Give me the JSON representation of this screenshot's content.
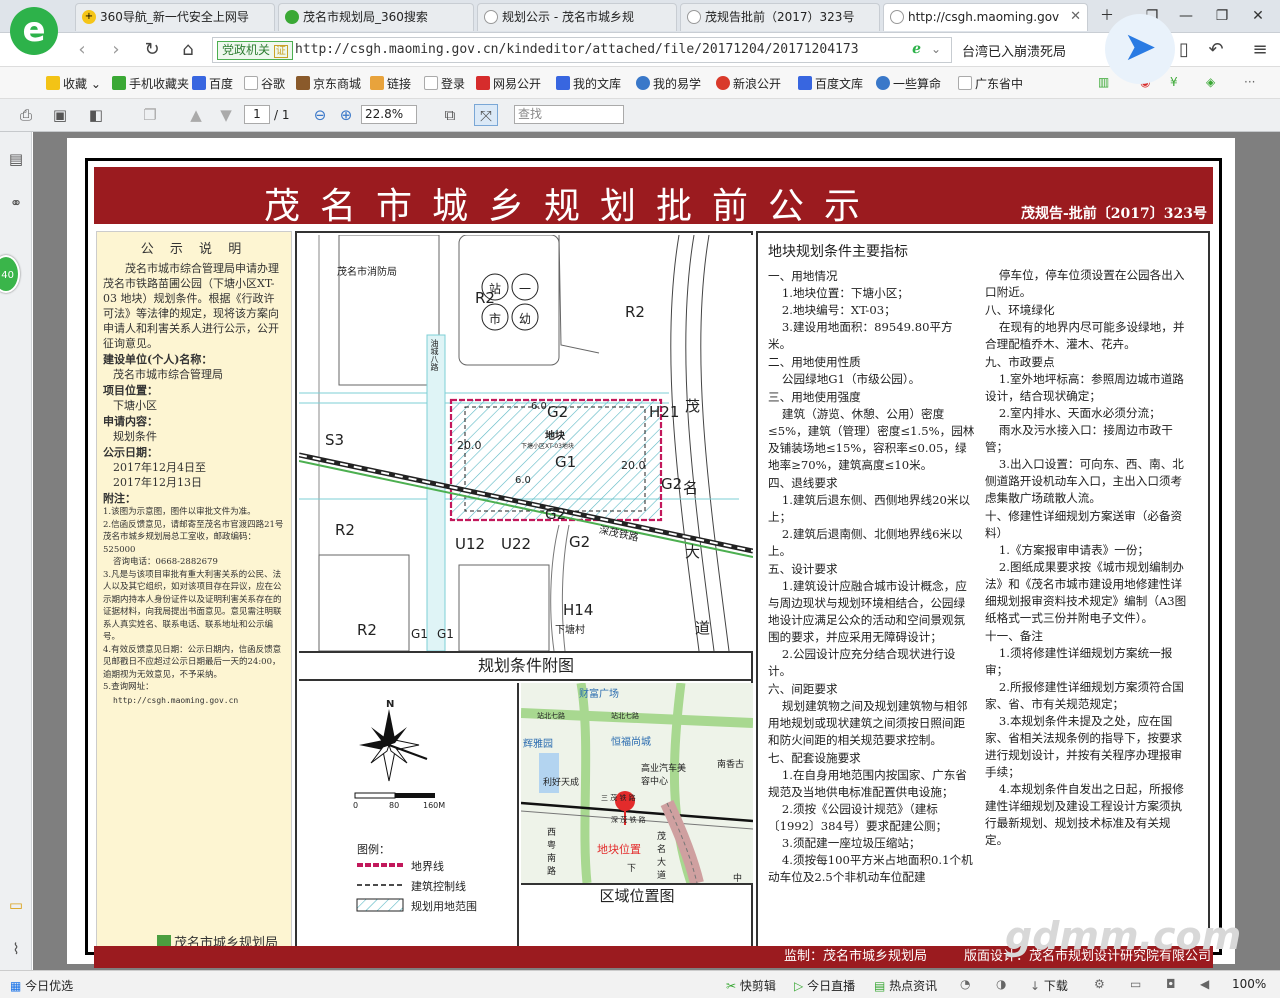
{
  "browser": {
    "tabs": [
      {
        "label": "360导航_新一代安全上网导"
      },
      {
        "label": "茂名市规划局_360搜索"
      },
      {
        "label": "规划公示 - 茂名市城乡规"
      },
      {
        "label": "茂规告批前（2017）323号"
      },
      {
        "label": "http://csgh.maoming.gov"
      }
    ],
    "url": "http://csgh.maoming.gov.cn/kindeditor/attached/file/20171204/20171204173",
    "url_badge": "党政机关",
    "badge_mark": "证",
    "search_text": "台湾已入崩溃死局"
  },
  "bookmarks": [
    "收藏",
    "手机收藏夹",
    "百度",
    "谷歌",
    "京东商城",
    "链接",
    "登录",
    "网易公开",
    "我的文库",
    "我的易学",
    "新浪公开",
    "百度文库",
    "一些算命",
    "广东省中"
  ],
  "pdf_toolbar": {
    "page": "1",
    "total": "/ 1",
    "zoom": "22.8%",
    "find_placeholder": "查找"
  },
  "side_badge": "40",
  "document": {
    "title": "茂名市城乡规划批前公示",
    "doc_number": "茂规告-批前〔2017〕323号",
    "notice_heading": "公 示 说 明",
    "notice_text": "茂名市城市综合管理局申请办理茂名市铁路苗圃公园（下塘小区XT-03 地块）规划条件。根据《行政许可法》等法律的规定，现将该方案向申请人和利害关系人进行公示，公开征询意见。",
    "fields": [
      {
        "key": "建设单位(个人)名称：",
        "value": "茂名市城市综合管理局"
      },
      {
        "key": "项目位置：",
        "value": "下塘小区"
      },
      {
        "key": "申请内容：",
        "value": "规划条件"
      },
      {
        "key": "公示日期：",
        "value": "2017年12月4日至"
      },
      {
        "key": "",
        "value": "2017年12月13日"
      }
    ],
    "notes_heading": "附注：",
    "notes": [
      "1.该图为示意图，图件以审批文件为准。",
      "2.信函反馈意见，请邮寄至茂名市官渡四路21号茂名市城乡规划局总工室收，邮政编码：525000",
      "咨询电话：0668-2882679",
      "3.凡是与该项目审批有重大利害关系的公民、法人以及其它组织，如对该项目存在异议，应在公示期内持本人身份证件以及证明利害关系存在的证据材料，向我局提出书面意见。意见需注明联系人真实姓名、联系电话、联系地址和公示编号。",
      "4.有效反馈意见日期：公示日期内，信函反馈意见邮戳日不应超过公示日期最后一天的24:00，逾期视为无效意见，不予采纳。",
      "5.查询网址："
    ],
    "query_url": "http://csgh.maoming.gov.cn",
    "footer_org": "茂名市城乡规划局",
    "map": {
      "caption": "规划条件附图",
      "labels": [
        "茂名市消防局",
        "R2",
        "R2",
        "S3",
        "R2",
        "R2",
        "G2",
        "G1",
        "G2",
        "G2",
        "G2",
        "H21",
        "H14",
        "U12",
        "U22",
        "20.0",
        "20.0",
        "6.0",
        "6.0",
        "茂",
        "名",
        "大",
        "道",
        "下塘村",
        "下塘小区XT-03地块",
        "地块",
        "油城八路",
        "G1",
        "G1"
      ],
      "circles": [
        "站",
        "一",
        "市",
        "幼"
      ],
      "rail_label": "深茂铁路"
    },
    "legend": {
      "heading": "图例：",
      "items": [
        "地界线",
        "建筑控制线",
        "规划用地范围"
      ],
      "scale": [
        "0",
        "80",
        "160M"
      ],
      "north": "N"
    },
    "location": {
      "caption": "区域位置图",
      "labels": [
        "财富广场",
        "站北七路",
        "站北七路",
        "辉雅园",
        "恒福尚城",
        "利好天成",
        "高业汽车美容中心",
        "南香古",
        "三 茂 铁 路",
        "深 茂 铁 路",
        "西粤南路",
        "地块位置",
        "茂名大道",
        "中",
        "下"
      ]
    },
    "conditions_heading": "地块规划条件主要指标",
    "conditions_col1": [
      "一、用地情况",
      "1.地块位置：下塘小区；",
      "2.地块编号：XT-03；",
      "3.建设用地面积：89549.80平方米。",
      "二、用地使用性质",
      "公园绿地G1（市级公园）。",
      "三、用地使用强度",
      "建筑（游览、休憩、公用）密度≤5%，建筑（管理）密度≤1.5%，园林及铺装场地≤15%，容积率≤0.05，绿地率≥70%，建筑高度≤10米。",
      "四、退线要求",
      "1.建筑后退东侧、西侧地界线20米以上；",
      "2.建筑后退南侧、北侧地界线6米以上。",
      "五、设计要求",
      "1.建筑设计应融合城市设计概念，应与周边现状与规划环境相结合，公园绿地设计应满足公众的活动和空间景观氛围的要求，并应采用无障碍设计；",
      "2.公园设计应充分结合现状进行设计。",
      "六、间距要求",
      "规划建筑物之间及规划建筑物与相邻用地规划或现状建筑之间须按日照间距和防火间距的相关规范要求控制。",
      "七、配套设施要求",
      "1.在自身用地范围内按国家、广东省规范及当地供电标准配置供电设施；",
      "2.须按《公园设计规范》（建标〔1992〕384号）要求配建公厕；",
      "3.须配建一座垃圾压缩站；",
      "4.须按每100平方米占地面积0.1个机动车位及2.5个非机动车位配建"
    ],
    "conditions_col2": [
      "停车位，停车位须设置在公园各出入口附近。",
      "八、环境绿化",
      "在现有的地界内尽可能多设绿地，并合理配植乔木、灌木、花卉。",
      "九、市政要点",
      "1.室外地坪标高：参照周边城市道路设计，结合现状确定；",
      "2.室内排水、天面水必须分流；",
      "雨水及污水接入口：接周边市政干管；",
      "3.出入口设置：可向东、西、南、北侧道路开设机动车入口，主出入口须考虑集散广场疏散人流。",
      "十、修建性详细规划方案送审（必备资料）",
      "1.《方案报审申请表》一份；",
      "2.图纸成果要求按《城市规划编制办法》和《茂名市城市建设用地修建性详细规划报审资料技术规定》编制（A3图纸格式一式三份并附电子文件）。",
      "十一、备注",
      "1.须将修建性详细规划方案统一报审；",
      "2.所报修建性详细规划方案须符合国家、省、市有关规范规定；",
      "3.本规划条件未提及之处，应在国家、省相关法规条例的指导下，按要求进行规划设计，并按有关程序办理报审手续；",
      "4.本规划条件自发出之日起，所报修建性详细规划及建设工程设计方案须执行最新规划、规划技术标准及有关规定。"
    ],
    "supervisor": "监制：茂名市城乡规划局",
    "design": "版面设计：茂名市规划设计研究院有限公司"
  },
  "watermark": "gdmm.com",
  "statusbar": [
    "今日优选",
    "快剪辑",
    "今日直播",
    "热点资讯",
    "下载",
    "100%"
  ]
}
